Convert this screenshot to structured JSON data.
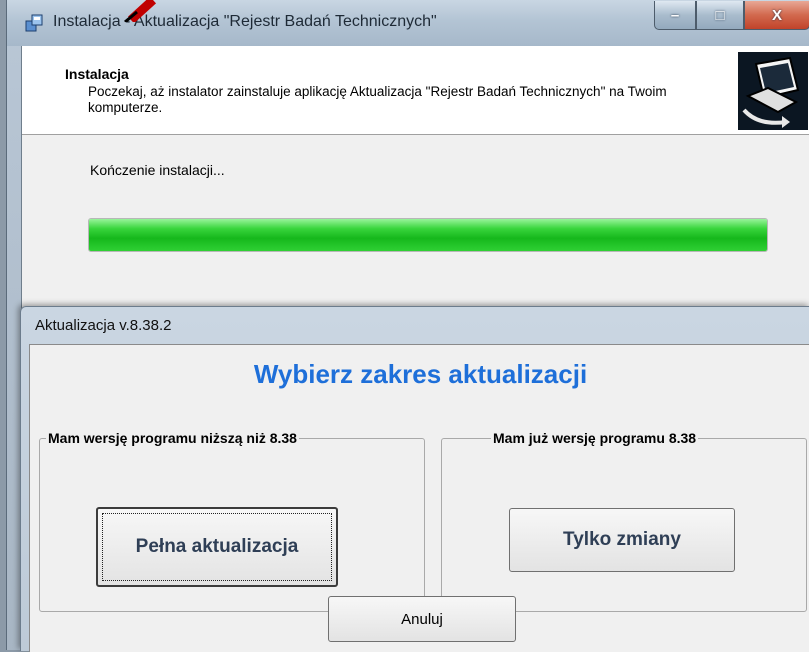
{
  "installer": {
    "title": "Instalacja - Aktualizacja \"Rejestr Badań Technicznych\"",
    "header_title": "Instalacja",
    "header_description": "Poczekaj, aż instalator zainstaluje aplikację Aktualizacja \"Rejestr Badań Technicznych\" na Twoim komputerze.",
    "status_text": "Kończenie instalacji...",
    "progress_percent": 100,
    "progress_color": "#16b81c",
    "window_buttons": {
      "minimize": "–",
      "maximize": "□",
      "close": "X"
    },
    "icons": {
      "title": "installer-box-icon",
      "logo": "computer-install-icon"
    }
  },
  "dialog": {
    "title": "Aktualizacja v.8.38.2",
    "heading": "Wybierz zakres aktualizacji",
    "heading_color": "#1e6fd9",
    "groups": [
      {
        "legend": "Mam wersję programu niższą niż 8.38",
        "button": "Pełna aktualizacja"
      },
      {
        "legend": "Mam już wersję programu 8.38",
        "button": "Tylko zmiany"
      }
    ],
    "cancel_label": "Anuluj"
  }
}
